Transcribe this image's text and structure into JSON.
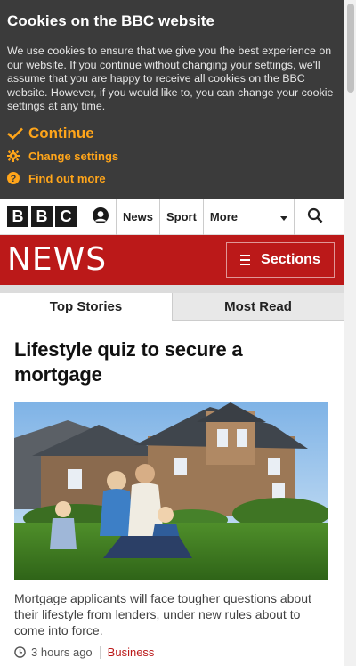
{
  "cookie_banner": {
    "title": "Cookies on the BBC website",
    "body": "We use cookies to ensure that we give you the best experience on our website. If you continue without changing your settings, we'll assume that you are happy to receive all cookies on the BBC website. However, if you would like to, you can change your cookie settings at any time.",
    "continue_label": "Continue",
    "change_settings_label": "Change settings",
    "find_out_more_label": "Find out more"
  },
  "global_nav": {
    "logo_letters": [
      "B",
      "B",
      "C"
    ],
    "items": [
      {
        "label": "News"
      },
      {
        "label": "Sport"
      },
      {
        "label": "More"
      }
    ]
  },
  "news_header": {
    "logo": "NEWS",
    "sections_label": "Sections"
  },
  "tabs": [
    {
      "label": "Top Stories",
      "active": true
    },
    {
      "label": "Most Read",
      "active": false
    }
  ],
  "story": {
    "headline": "Lifestyle quiz to secure a mortgage",
    "summary": "Mortgage applicants will face tougher questions about their lifestyle from lenders, under new rules about to come into force.",
    "time": "3 hours ago",
    "section": "Business"
  },
  "colors": {
    "cookie_bg": "#3b3b3b",
    "cookie_accent": "#ffa51a",
    "news_red": "#bb1919"
  }
}
